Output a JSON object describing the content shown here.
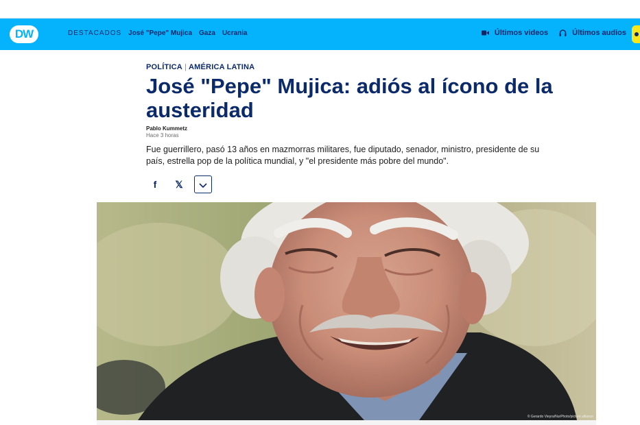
{
  "brand": {
    "logo_text": "DW",
    "accent": "#05b2fc",
    "navy": "#0b2a6b",
    "live_color": "#f8e71c"
  },
  "nav": {
    "lead_label": "DESTACADOS",
    "links": [
      "José \"Pepe\" Mujica",
      "Gaza",
      "Ucrania"
    ]
  },
  "right_nav": {
    "videos_label": "Últimos videos",
    "videos_icon": "video-camera-icon",
    "audios_label": "Últimos audios",
    "audios_icon": "headphones-icon"
  },
  "article": {
    "kicker_section": "POLÍTICA",
    "kicker_separator": "|",
    "kicker_region": "AMÉRICA LATINA",
    "title": "José \"Pepe\" Mujica: adiós al ícono de la austeridad",
    "author": "Pablo Kummetz",
    "published": "Hace 3 horas",
    "lede": "Fue guerrillero, pasó 13 años en mazmorras militares, fue diputado, senador, ministro, presidente de su país, estrella pop de la política mundial, y \"el presidente más pobre del mundo\"."
  },
  "share": {
    "facebook_glyph": "f",
    "x_glyph": "𝕏",
    "icons": [
      "facebook-icon",
      "x-icon",
      "chevron-down-icon"
    ]
  },
  "photo": {
    "credit": "© Gerardo Vieyra/NurPhoto/picture alliance"
  }
}
